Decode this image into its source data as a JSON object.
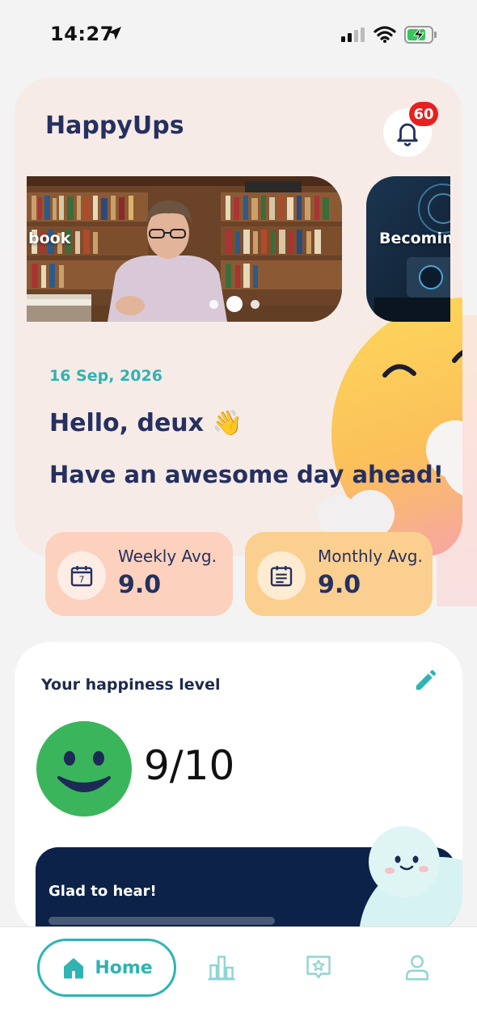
{
  "status_bar": {
    "time": "14:27"
  },
  "header": {
    "app_title": "HappyUps",
    "notification_count": "60"
  },
  "carousel": {
    "slides": [
      {
        "label": "book"
      },
      {
        "label": "Becoming"
      }
    ],
    "page_count": 3,
    "active_index": 1
  },
  "greeting": {
    "date": "16 Sep, 2026",
    "hello": "Hello, deux 👋",
    "tagline": "Have an awesome day ahead!"
  },
  "stats": {
    "weekly": {
      "label": "Weekly Avg.",
      "value": "9.0",
      "icon_text": "7"
    },
    "monthly": {
      "label": "Monthly Avg.",
      "value": "9.0"
    }
  },
  "happiness": {
    "title": "Your happiness level",
    "score": "9/10",
    "message_title": "Glad to hear!"
  },
  "nav": {
    "items": [
      {
        "label": "Home",
        "icon": "home-icon",
        "active": true
      },
      {
        "label": "",
        "icon": "chart-icon"
      },
      {
        "label": "",
        "icon": "star-chat-icon"
      },
      {
        "label": "",
        "icon": "profile-icon"
      }
    ]
  },
  "colors": {
    "accent": "#2fb3b3",
    "navy": "#25305f",
    "badge": "#e8201f",
    "weekly_card": "#fcd1bd",
    "monthly_card": "#fbcf8f",
    "happy_face": "#3bb55b"
  }
}
